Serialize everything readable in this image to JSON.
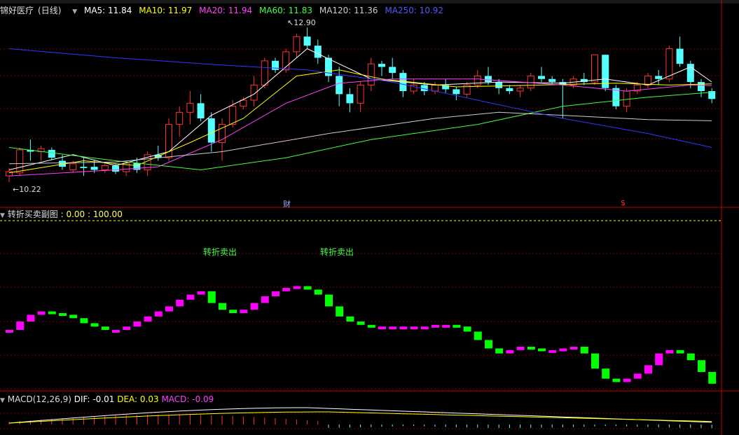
{
  "stock": {
    "name": "锦好医疗",
    "period": "(日线)"
  },
  "ma_header": {
    "ma5": "MA5: 11.84",
    "ma10": "MA10: 11.97",
    "ma20": "MA20: 11.94",
    "ma60": "MA60: 11.83",
    "ma120": "MA120: 11.36",
    "ma250": "MA250: 10.92"
  },
  "colors": {
    "up": "#ff3232",
    "down": "#54ffff",
    "ma5": "#ffffff",
    "ma10": "#ffff00",
    "ma20": "#ff40ff",
    "ma60": "#40ff40",
    "ma120": "#cccccc",
    "ma250": "#3333ff",
    "buy": "#ff00ff",
    "sell": "#00ff00",
    "grid": "#800000"
  },
  "price_labels": {
    "high": "12.90",
    "low": "10.22"
  },
  "markers": {
    "cai": "财",
    "dollar": "$"
  },
  "sub_indicator": {
    "title": "转折买卖副图",
    "range": ": 0.00 : 100.00",
    "signals": [
      {
        "text": "转折卖出",
        "index": 18
      },
      {
        "text": "转折卖出",
        "index": 29
      }
    ],
    "values": [
      35,
      40,
      44,
      46,
      45,
      44,
      42,
      39,
      37,
      35,
      35,
      37,
      40,
      43,
      46,
      49,
      53,
      56,
      58,
      51,
      47,
      45,
      47,
      51,
      55,
      58,
      60,
      61,
      59,
      56,
      49,
      43,
      40,
      38,
      37,
      37,
      37,
      37,
      37,
      37,
      38,
      38,
      37,
      34,
      29,
      24,
      21,
      23,
      25,
      24,
      23,
      23,
      24,
      25,
      21,
      12,
      6,
      4,
      6,
      9,
      14,
      21,
      23,
      21,
      17,
      10,
      3
    ]
  },
  "macd": {
    "title": "MACD(12,26,9)",
    "dif": "DIF: -0.01",
    "dea": "DEA: 0.03",
    "macd": "MACD: -0.09"
  },
  "chart_data": {
    "type": "candlestick",
    "title": "锦好医疗 (日线)",
    "ylim": [
      10.0,
      13.1
    ],
    "ohlc": [
      [
        10.45,
        10.58,
        10.35,
        10.52
      ],
      [
        10.5,
        10.92,
        10.45,
        10.88
      ],
      [
        10.88,
        11.05,
        10.7,
        10.85
      ],
      [
        10.85,
        10.95,
        10.7,
        10.9
      ],
      [
        10.88,
        10.92,
        10.72,
        10.75
      ],
      [
        10.7,
        10.8,
        10.55,
        10.6
      ],
      [
        10.55,
        10.7,
        10.5,
        10.65
      ],
      [
        10.6,
        10.75,
        10.45,
        10.58
      ],
      [
        10.6,
        10.72,
        10.5,
        10.55
      ],
      [
        10.55,
        10.68,
        10.5,
        10.62
      ],
      [
        10.62,
        10.65,
        10.48,
        10.52
      ],
      [
        10.52,
        10.7,
        10.45,
        10.66
      ],
      [
        10.66,
        10.75,
        10.5,
        10.55
      ],
      [
        10.55,
        10.85,
        10.45,
        10.8
      ],
      [
        10.8,
        10.95,
        10.7,
        10.75
      ],
      [
        10.75,
        11.4,
        10.7,
        11.3
      ],
      [
        11.3,
        11.6,
        11.1,
        11.5
      ],
      [
        11.5,
        11.85,
        11.3,
        11.65
      ],
      [
        11.65,
        11.8,
        11.35,
        11.4
      ],
      [
        11.4,
        11.5,
        10.85,
        11.0
      ],
      [
        11.0,
        11.4,
        10.7,
        11.3
      ],
      [
        11.3,
        11.7,
        11.25,
        11.6
      ],
      [
        11.6,
        11.75,
        11.55,
        11.7
      ],
      [
        11.7,
        12.1,
        11.6,
        11.95
      ],
      [
        11.95,
        12.4,
        11.9,
        12.35
      ],
      [
        12.35,
        12.4,
        12.15,
        12.2
      ],
      [
        12.2,
        12.55,
        12.15,
        12.5
      ],
      [
        12.5,
        12.8,
        12.4,
        12.75
      ],
      [
        12.75,
        12.9,
        12.55,
        12.6
      ],
      [
        12.6,
        12.7,
        12.3,
        12.4
      ],
      [
        12.4,
        12.45,
        12.0,
        12.1
      ],
      [
        12.1,
        12.25,
        11.6,
        11.8
      ],
      [
        11.8,
        11.9,
        11.5,
        11.65
      ],
      [
        11.65,
        12.0,
        11.5,
        11.95
      ],
      [
        11.95,
        12.4,
        11.85,
        12.3
      ],
      [
        12.3,
        12.35,
        12.1,
        12.25
      ],
      [
        12.25,
        12.4,
        12.05,
        12.15
      ],
      [
        12.15,
        12.2,
        11.75,
        11.85
      ],
      [
        11.85,
        12.05,
        11.8,
        11.95
      ],
      [
        11.95,
        12.0,
        11.78,
        11.85
      ],
      [
        11.85,
        12.0,
        11.8,
        11.95
      ],
      [
        11.95,
        12.05,
        11.82,
        11.88
      ],
      [
        11.88,
        11.92,
        11.7,
        11.8
      ],
      [
        11.8,
        12.0,
        11.75,
        11.95
      ],
      [
        11.95,
        12.2,
        11.9,
        12.1
      ],
      [
        12.1,
        12.25,
        11.95,
        12.0
      ],
      [
        12.0,
        12.05,
        11.8,
        11.9
      ],
      [
        11.9,
        11.95,
        11.8,
        11.85
      ],
      [
        11.85,
        11.95,
        11.75,
        11.9
      ],
      [
        11.9,
        12.15,
        11.85,
        12.1
      ],
      [
        12.1,
        12.25,
        12.0,
        12.05
      ],
      [
        12.05,
        12.1,
        11.95,
        12.0
      ],
      [
        12.0,
        12.05,
        11.4,
        11.95
      ],
      [
        11.95,
        12.1,
        11.9,
        12.05
      ],
      [
        12.05,
        12.15,
        11.95,
        12.0
      ],
      [
        12.0,
        12.45,
        11.95,
        12.45
      ],
      [
        12.45,
        12.45,
        11.85,
        11.9
      ],
      [
        11.9,
        11.95,
        11.55,
        11.6
      ],
      [
        11.6,
        11.9,
        11.5,
        11.85
      ],
      [
        11.85,
        12.0,
        11.8,
        11.95
      ],
      [
        11.95,
        12.15,
        11.9,
        12.1
      ],
      [
        12.1,
        12.2,
        11.95,
        12.05
      ],
      [
        12.05,
        12.6,
        12.0,
        12.55
      ],
      [
        12.55,
        12.75,
        12.25,
        12.3
      ],
      [
        12.3,
        12.35,
        11.9,
        12.0
      ],
      [
        12.0,
        12.05,
        11.75,
        11.85
      ],
      [
        11.85,
        11.9,
        11.65,
        11.72
      ]
    ],
    "ma": {
      "ma5": [
        [
          0,
          10.55
        ],
        [
          6,
          10.8
        ],
        [
          10,
          10.62
        ],
        [
          15,
          10.85
        ],
        [
          19,
          11.45
        ],
        [
          23,
          11.8
        ],
        [
          28,
          12.55
        ],
        [
          31,
          12.3
        ],
        [
          34,
          12.05
        ],
        [
          40,
          11.95
        ],
        [
          46,
          12.0
        ],
        [
          52,
          11.98
        ],
        [
          56,
          12.05
        ],
        [
          60,
          11.95
        ],
        [
          64,
          12.25
        ],
        [
          66,
          12.0
        ]
      ],
      "ma10": [
        [
          0,
          10.5
        ],
        [
          7,
          10.7
        ],
        [
          12,
          10.62
        ],
        [
          17,
          11.0
        ],
        [
          22,
          11.4
        ],
        [
          27,
          12.1
        ],
        [
          31,
          12.2
        ],
        [
          35,
          12.05
        ],
        [
          42,
          11.92
        ],
        [
          50,
          11.95
        ],
        [
          57,
          11.98
        ],
        [
          62,
          11.95
        ],
        [
          66,
          11.97
        ]
      ],
      "ma20": [
        [
          0,
          10.45
        ],
        [
          10,
          10.55
        ],
        [
          14,
          10.6
        ],
        [
          20,
          11.05
        ],
        [
          26,
          11.65
        ],
        [
          31,
          11.98
        ],
        [
          36,
          12.05
        ],
        [
          44,
          12.05
        ],
        [
          52,
          11.95
        ],
        [
          58,
          11.85
        ],
        [
          64,
          11.95
        ],
        [
          66,
          11.94
        ]
      ],
      "ma60": [
        [
          0,
          10.92
        ],
        [
          10,
          10.7
        ],
        [
          18,
          10.55
        ],
        [
          26,
          10.75
        ],
        [
          34,
          11.05
        ],
        [
          44,
          11.3
        ],
        [
          52,
          11.6
        ],
        [
          60,
          11.75
        ],
        [
          66,
          11.83
        ]
      ],
      "ma120": [
        [
          0,
          10.65
        ],
        [
          10,
          10.68
        ],
        [
          20,
          10.85
        ],
        [
          30,
          11.15
        ],
        [
          40,
          11.4
        ],
        [
          46,
          11.5
        ],
        [
          52,
          11.45
        ],
        [
          60,
          11.38
        ],
        [
          66,
          11.36
        ]
      ],
      "ma250": [
        [
          0,
          12.55
        ],
        [
          10,
          12.4
        ],
        [
          20,
          12.28
        ],
        [
          28,
          12.2
        ],
        [
          36,
          12.0
        ],
        [
          44,
          11.7
        ],
        [
          52,
          11.4
        ],
        [
          60,
          11.15
        ],
        [
          66,
          10.92
        ]
      ]
    }
  }
}
